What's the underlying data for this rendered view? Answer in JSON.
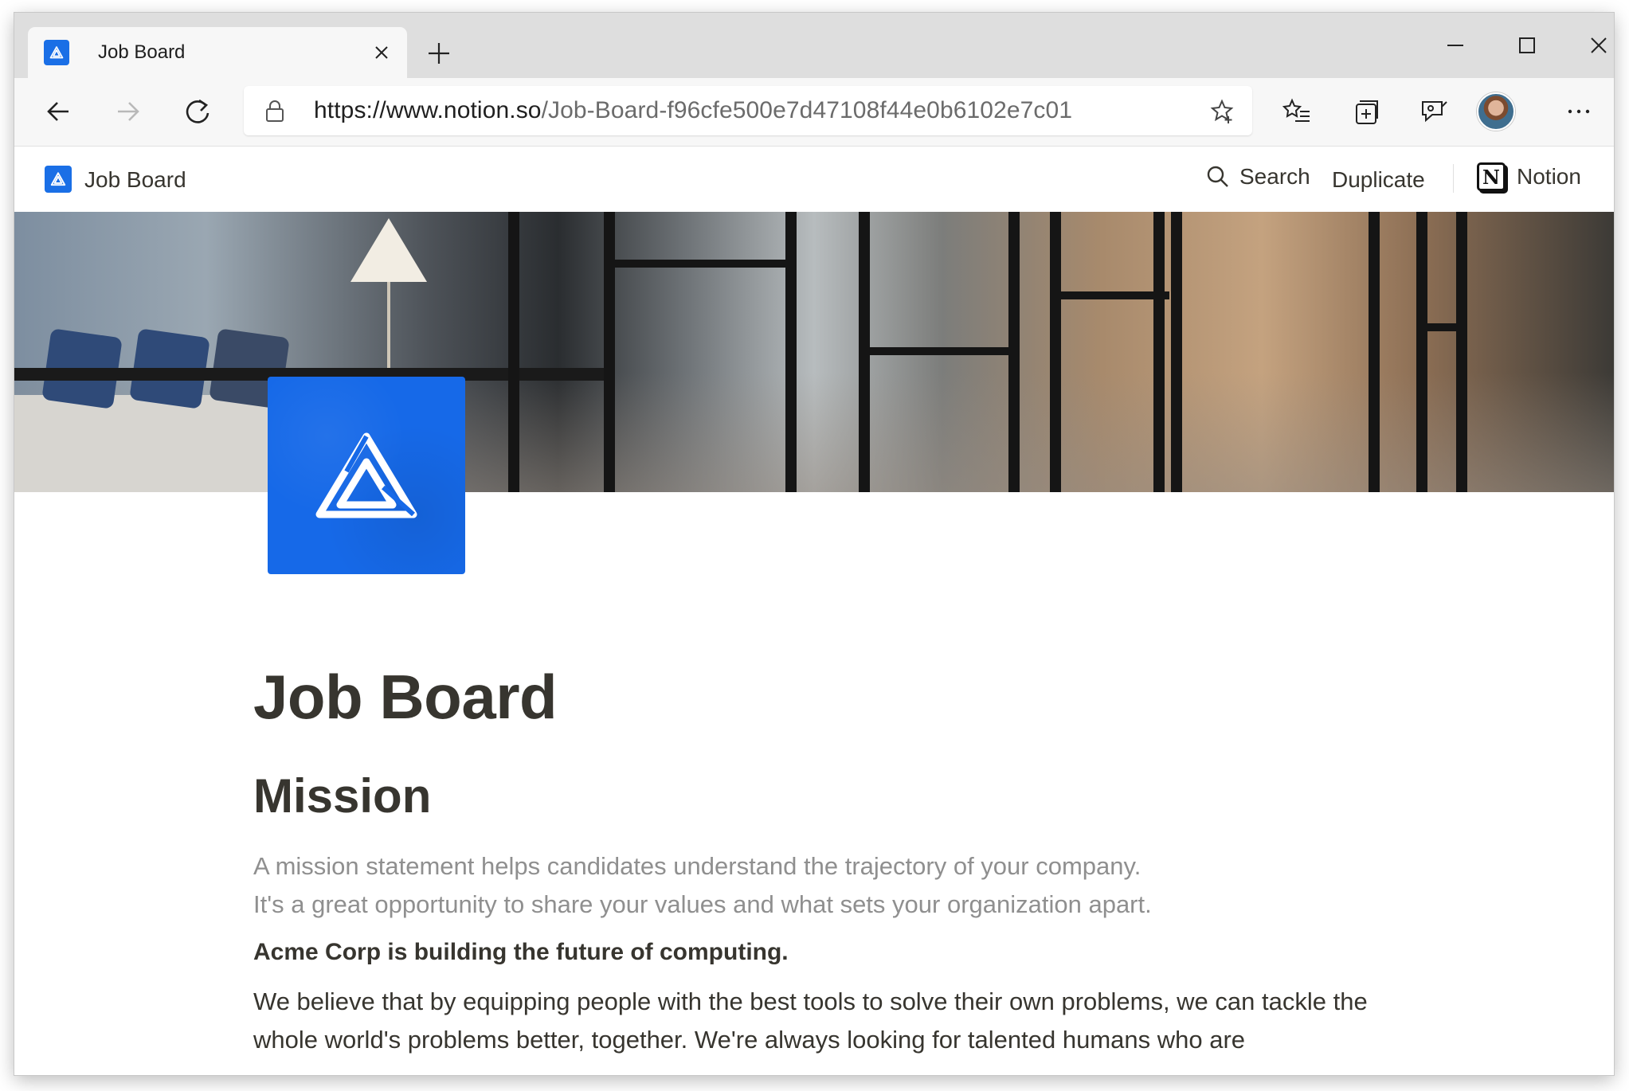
{
  "browser": {
    "tab_title": "Job Board",
    "url_host": "https://www.notion.so",
    "url_path": "/Job-Board-f96cfe500e7d47108f44e0b6102e7c01"
  },
  "notion_bar": {
    "page_title": "Job Board",
    "search_label": "Search",
    "duplicate_label": "Duplicate",
    "notion_label": "Notion"
  },
  "page": {
    "title": "Job Board",
    "heading": "Mission",
    "placeholder_line1": "A mission statement helps candidates understand the trajectory of your company.",
    "placeholder_line2": "It's a great opportunity to share your values and what sets your organization apart.",
    "bold_statement": "Acme Corp is building the future of computing.",
    "paragraph": "We believe that by equipping people with the best tools to solve their own problems, we can tackle the whole world's problems better, together. We're always looking for talented humans who are"
  },
  "icons": {
    "favicon": "acme-triangle-icon",
    "page_icon": "acme-triangle-icon",
    "search": "search-icon",
    "notion_logo": "notion-logo-icon"
  },
  "colors": {
    "accent_blue": "#1669e8",
    "text": "#37352f",
    "placeholder": "#8f8f8f"
  }
}
